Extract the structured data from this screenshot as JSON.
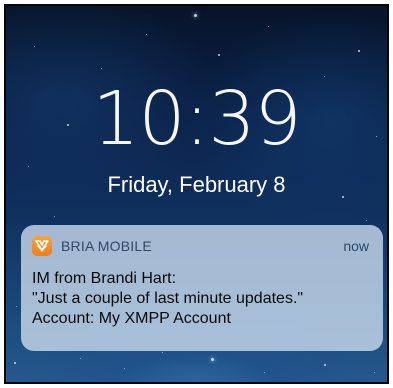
{
  "lock_screen": {
    "time": "10:39",
    "date": "Friday, February 8"
  },
  "notification": {
    "app_name": "BRIA MOBILE",
    "app_icon": "bria-app-icon",
    "timestamp": "now",
    "title": "IM from Brandi Hart:",
    "message": "\"Just a couple of last minute updates.\"",
    "account": "Account: My XMPP Account"
  },
  "colors": {
    "app_icon_orange": "#F39A2E",
    "notification_bg": "#C6D8EA",
    "header_text": "#2F4A66",
    "wallpaper_dark": "#0B2148"
  }
}
